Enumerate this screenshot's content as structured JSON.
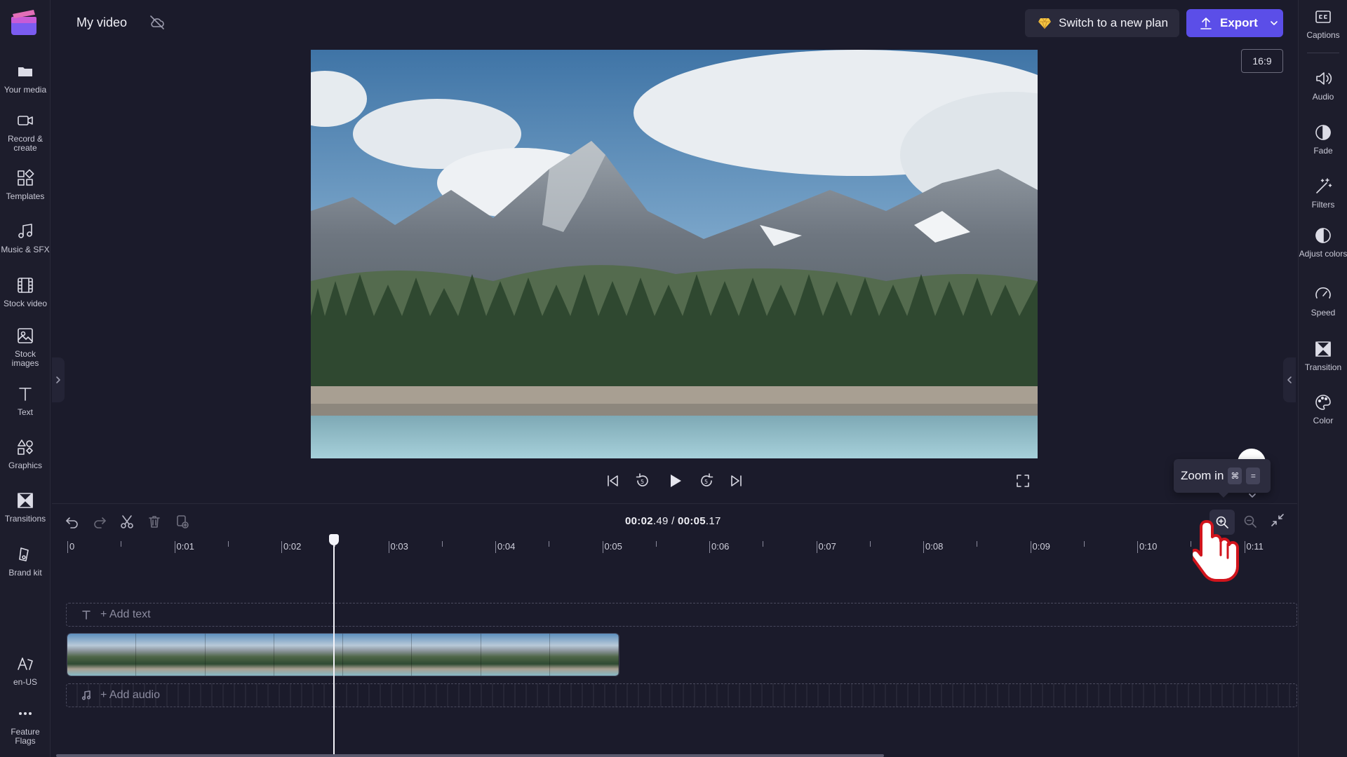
{
  "app": {
    "project_title": "My video"
  },
  "left_rail": {
    "items": [
      {
        "label": "Your media",
        "icon": "folder-icon"
      },
      {
        "label": "Record & create",
        "icon": "camera-icon"
      },
      {
        "label": "Templates",
        "icon": "templates-icon"
      },
      {
        "label": "Music & SFX",
        "icon": "music-note-icon"
      },
      {
        "label": "Stock video",
        "icon": "film-icon"
      },
      {
        "label": "Stock images",
        "icon": "image-icon"
      },
      {
        "label": "Text",
        "icon": "text-icon"
      },
      {
        "label": "Graphics",
        "icon": "shapes-icon"
      },
      {
        "label": "Transitions",
        "icon": "transition-icon"
      },
      {
        "label": "Brand kit",
        "icon": "brand-kit-icon"
      },
      {
        "label": "en-US",
        "icon": "language-icon"
      },
      {
        "label": "Feature Flags",
        "icon": "more-icon"
      }
    ]
  },
  "header": {
    "upgrade_label": "Switch to a new plan",
    "export_label": "Export",
    "aspect_ratio": "16:9"
  },
  "right_rail": {
    "items": [
      {
        "label": "Captions",
        "icon": "captions-icon"
      },
      {
        "label": "Audio",
        "icon": "speaker-icon"
      },
      {
        "label": "Fade",
        "icon": "fade-icon"
      },
      {
        "label": "Filters",
        "icon": "magic-wand-icon"
      },
      {
        "label": "Adjust colors",
        "icon": "contrast-icon"
      },
      {
        "label": "Speed",
        "icon": "speedometer-icon"
      },
      {
        "label": "Transition",
        "icon": "transition-icon"
      },
      {
        "label": "Color",
        "icon": "palette-icon"
      }
    ]
  },
  "player": {
    "current_time": "00:02",
    "current_frac": ".49",
    "separator": " / ",
    "total_time": "00:05",
    "total_frac": ".17"
  },
  "tooltip": {
    "label": "Zoom in",
    "key1": "⌘",
    "key2": "="
  },
  "timeline": {
    "ruler_labels": [
      "0",
      "0:01",
      "0:02",
      "0:03",
      "0:04",
      "0:05",
      "0:06",
      "0:07",
      "0:08",
      "0:09",
      "0:10",
      "0:11"
    ],
    "add_text_label": "+ Add text",
    "add_audio_label": "+ Add audio",
    "playhead_seconds": 2.49,
    "clip_duration_seconds": 5.17
  },
  "colors": {
    "accent": "#5b4ee8",
    "background": "#1b1b2b",
    "gem": "#f5c542"
  }
}
